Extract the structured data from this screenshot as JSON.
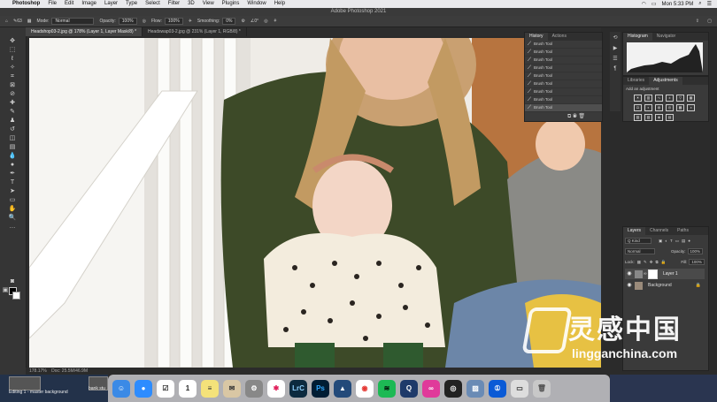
{
  "menubar": {
    "app_name": "Photoshop",
    "items": [
      "File",
      "Edit",
      "Image",
      "Layer",
      "Type",
      "Select",
      "Filter",
      "3D",
      "View",
      "Plugins",
      "Window",
      "Help"
    ],
    "clock": "Mon 5:33 PM"
  },
  "window_title": "Adobe Photoshop 2021",
  "options_bar": {
    "mode_label": "Mode:",
    "mode_value": "Normal",
    "opacity_label": "Opacity:",
    "opacity_value": "100%",
    "flow_label": "Flow:",
    "flow_value": "100%",
    "smoothing_label": "Smoothing:",
    "smoothing_value": "0%",
    "brush_size": "63",
    "angle_value": "0°"
  },
  "doc_tabs": [
    {
      "label": "Headshop03-2.jpg @ 178% (Layer 1, Layer Mask/8) *",
      "active": true
    },
    {
      "label": "Headswap03-2.jpg @ 231% (Layer 1, RGB/8) *",
      "active": false
    }
  ],
  "status": {
    "zoom": "178.17%",
    "doc": "Doc: 25.5M/46.9M"
  },
  "history": {
    "tabs": [
      "History",
      "Actions"
    ],
    "items": [
      "Brush Tool",
      "Brush Tool",
      "Brush Tool",
      "Brush Tool",
      "Brush Tool",
      "Brush Tool",
      "Brush Tool",
      "Brush Tool",
      "Brush Tool"
    ]
  },
  "histogram_tabs": [
    "Histogram",
    "Navigator"
  ],
  "adjustments": {
    "tabs": [
      "Libraries",
      "Adjustments"
    ],
    "add_label": "Add an adjustment"
  },
  "layers": {
    "tabs": [
      "Layers",
      "Channels",
      "Paths"
    ],
    "kind": "Q Kind",
    "blend": "Normal",
    "opacity_label": "Opacity:",
    "opacity_value": "100%",
    "lock_label": "Lock:",
    "fill_label": "Fill:",
    "fill_value": "100%",
    "items": [
      {
        "name": "Layer 1",
        "selected": true
      },
      {
        "name": "Background",
        "selected": false
      }
    ]
  },
  "desktop": {
    "thumb1_caption": "Editing 1 - master background",
    "thumb2_caption": "bank stu"
  },
  "dock_icons": [
    "finder-icon",
    "zoom-icon",
    "reminders-icon",
    "calendar-icon",
    "notes-icon",
    "mail-icon",
    "system-preferences-icon",
    "slack-icon",
    "lightroom-classic-icon",
    "photoshop-icon",
    "affinity-icon",
    "chrome-icon",
    "spotify-icon",
    "quicktime-icon",
    "creative-cloud-icon",
    "obs-icon",
    "preview-icon",
    "onepassword-icon",
    "screen-icon",
    "trash-icon"
  ],
  "dock_labels": {
    "calendar": "1",
    "lrc": "LrC",
    "ps": "Ps"
  },
  "watermark": {
    "cn": "灵感中国",
    "url": "lingganchina.com"
  },
  "colors": {
    "accent": "#2d7ce6",
    "canvas_bg": "#e8e3d8"
  }
}
